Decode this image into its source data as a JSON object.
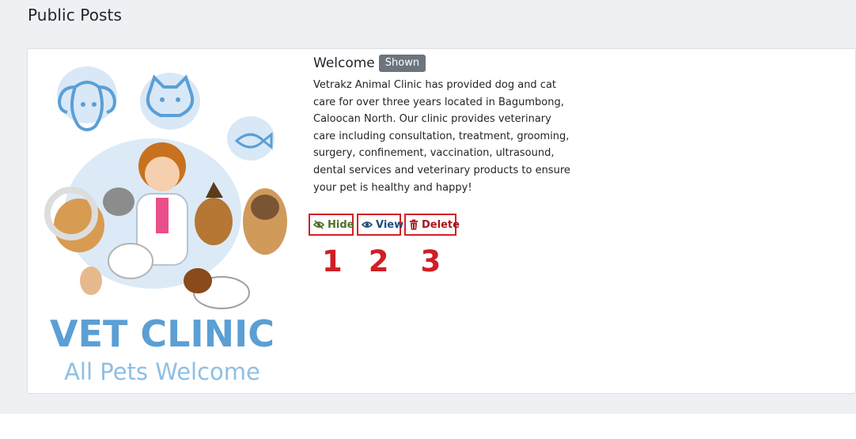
{
  "page": {
    "title": "Public Posts"
  },
  "post": {
    "title": "Welcome",
    "status_badge": "Shown",
    "body": "Vetrakz Animal Clinic has provided dog and cat care for over three years located in Bagumbong, Caloocan North. Our clinic provides veterinary care including consultation, treatment, grooming, surgery, confinement, vaccination, ultrasound, dental services and veterinary products to ensure your pet is healthy and happy!",
    "image": {
      "line1": "VET CLINIC",
      "line2": "All Pets Welcome"
    },
    "actions": [
      {
        "label": "Hide",
        "icon": "eye-slash-icon",
        "color": "#4e6f29"
      },
      {
        "label": "View",
        "icon": "eye-icon",
        "color": "#1f4f7b"
      },
      {
        "label": "Delete",
        "icon": "trash-icon",
        "color": "#a8161c"
      }
    ]
  },
  "annotations": {
    "numbers": [
      "1",
      "2",
      "3"
    ],
    "color": "#d01e25"
  }
}
